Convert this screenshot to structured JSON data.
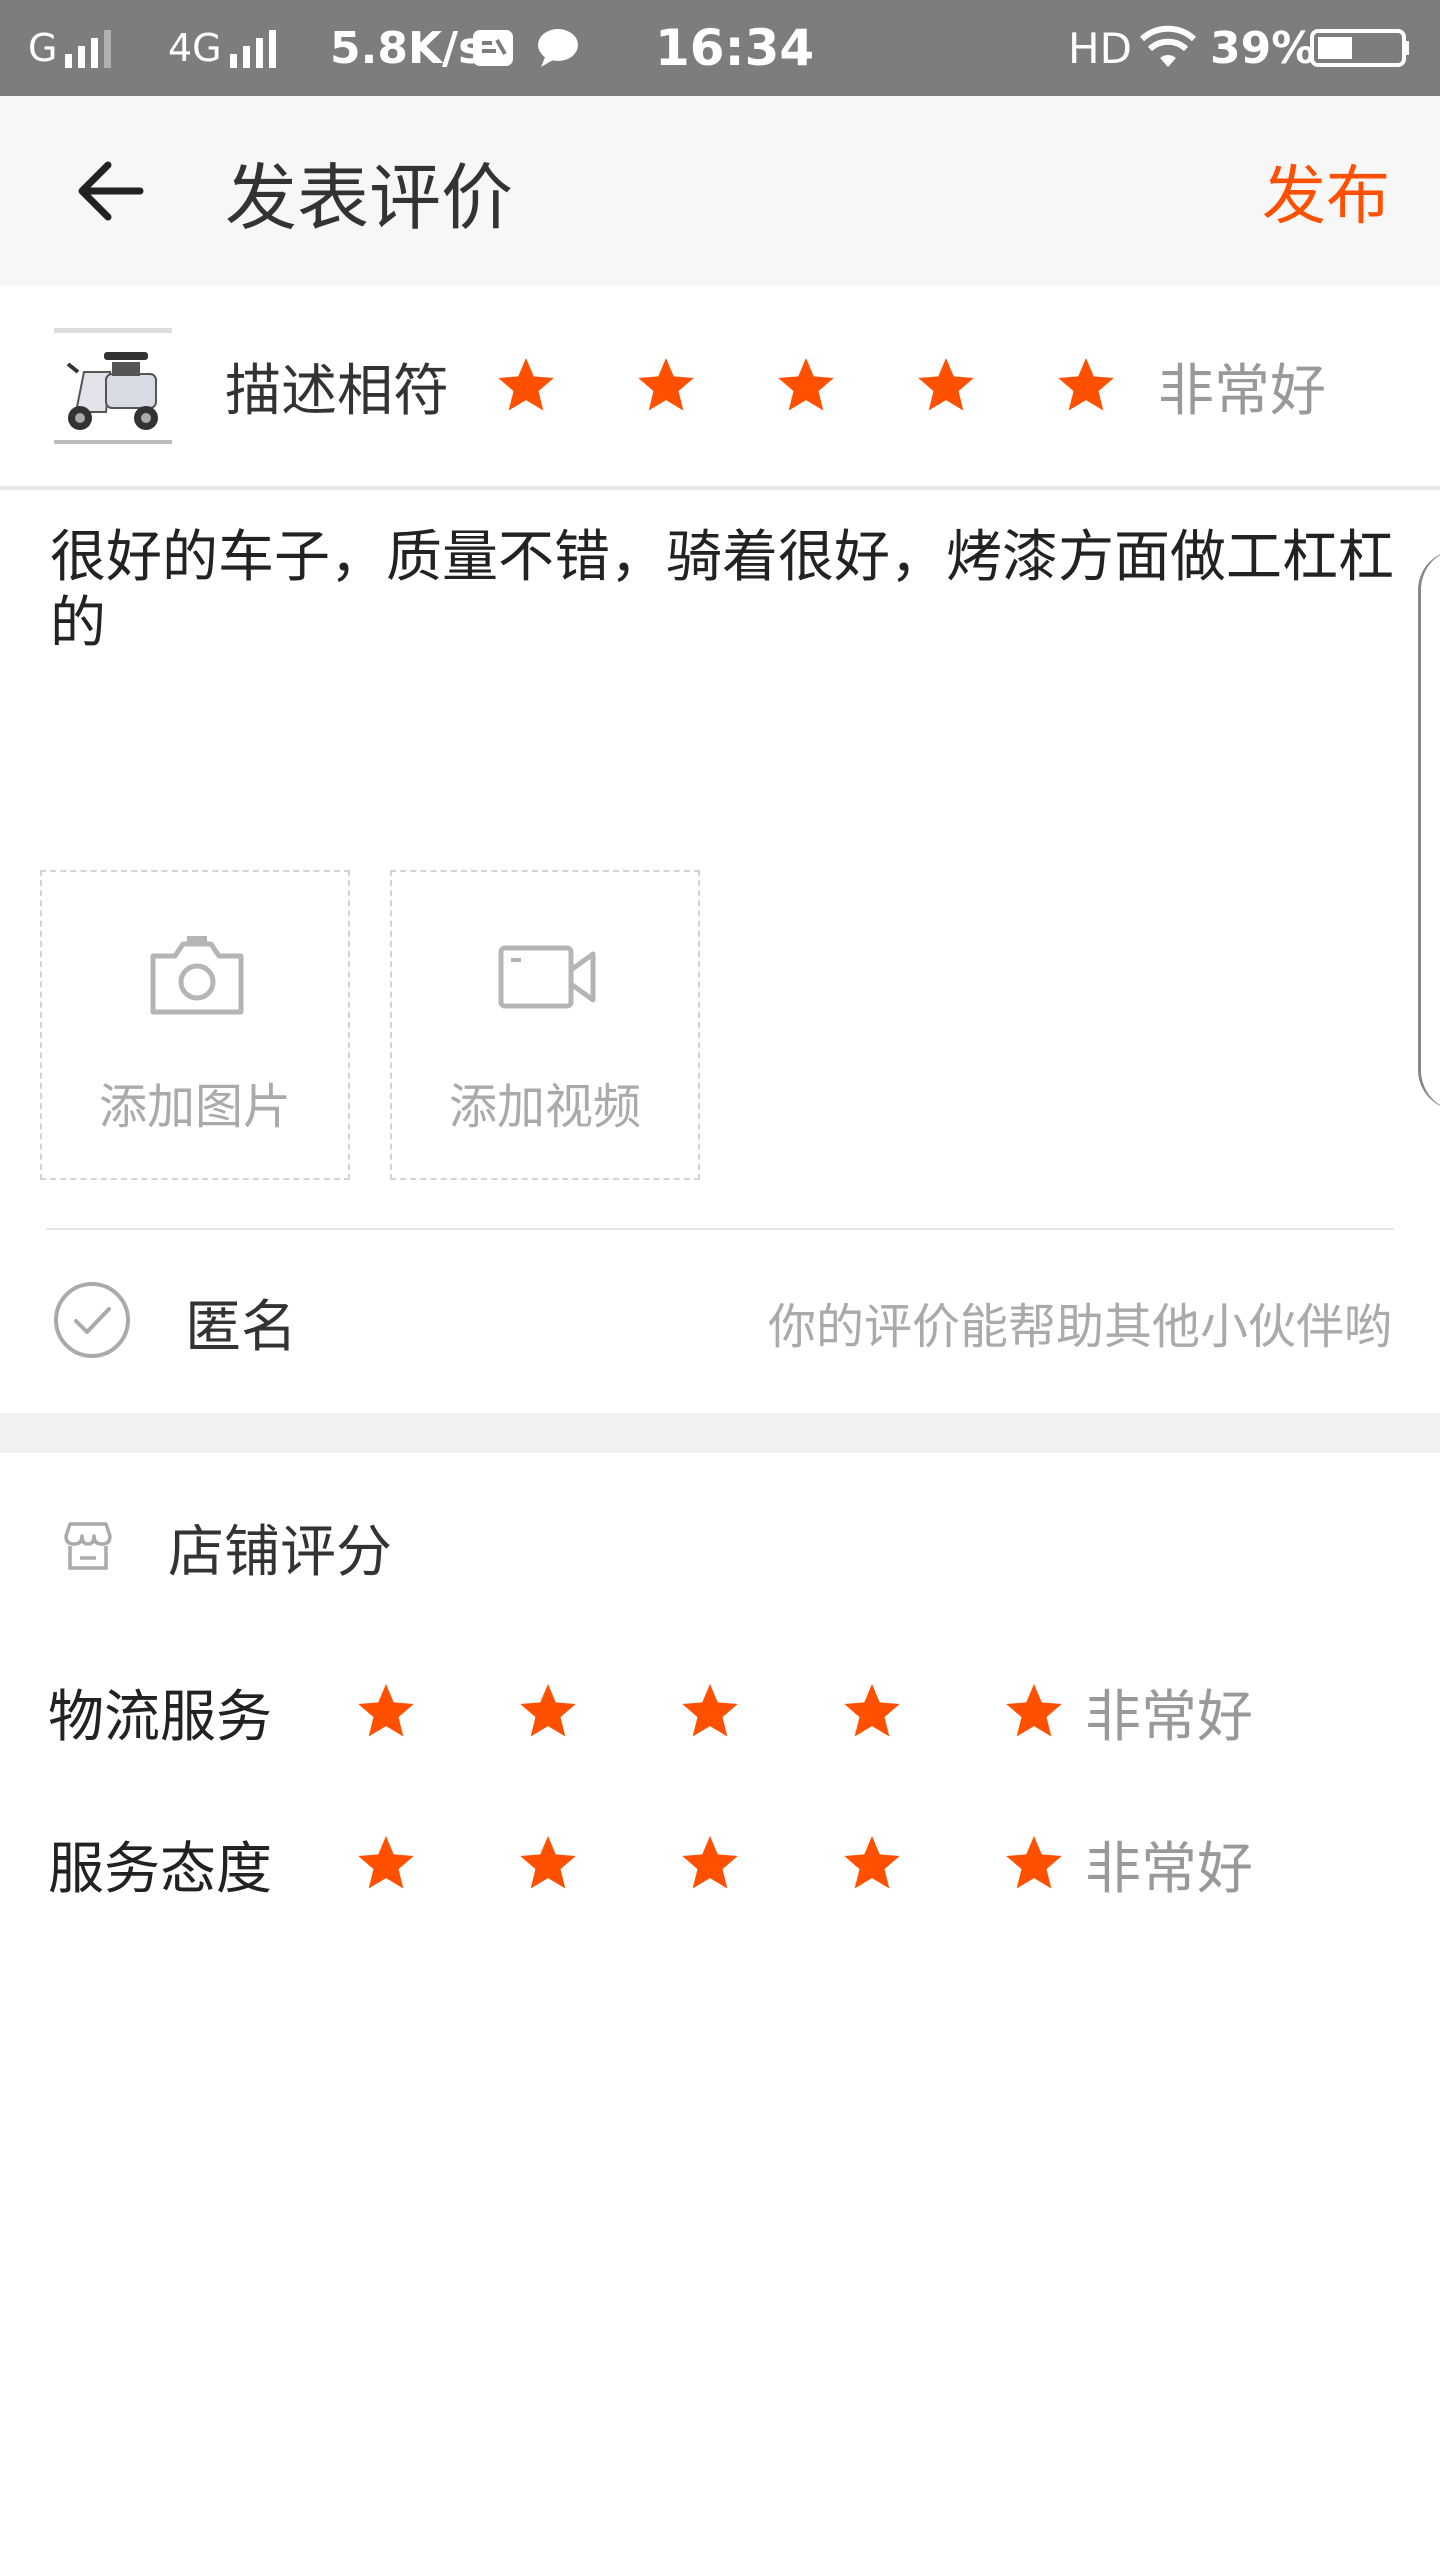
{
  "status_bar": {
    "network1": "G",
    "network2": "4G",
    "speed": "5.8K/s",
    "time": "16:34",
    "hd": "HD",
    "battery": "39%",
    "icons": [
      "signal-icon",
      "app-notification-icon",
      "message-icon",
      "wifi-icon",
      "battery-icon"
    ]
  },
  "header": {
    "title": "发表评价",
    "publish_label": "发布",
    "back_icon": "arrow-left-icon"
  },
  "product": {
    "label": "描述相符",
    "rating": 5,
    "max_rating": 5,
    "rating_text": "非常好"
  },
  "review": {
    "text": "很好的车子，质量不错，骑着很好，烤漆方面做工杠杠的"
  },
  "uploads": {
    "photo_label": "添加图片",
    "video_label": "添加视频"
  },
  "anonymous": {
    "label": "匿名",
    "hint": "你的评价能帮助其他小伙伴哟"
  },
  "store": {
    "title": "店铺评分",
    "ratings": [
      {
        "label": "物流服务",
        "rating": 5,
        "max_rating": 5,
        "text": "非常好"
      },
      {
        "label": "服务态度",
        "rating": 5,
        "max_rating": 5,
        "text": "非常好"
      }
    ]
  },
  "colors": {
    "accent": "#ff5000",
    "status_bar": "#7d7d7d",
    "header_bg": "#f7f7f7",
    "muted_text": "#999999"
  }
}
